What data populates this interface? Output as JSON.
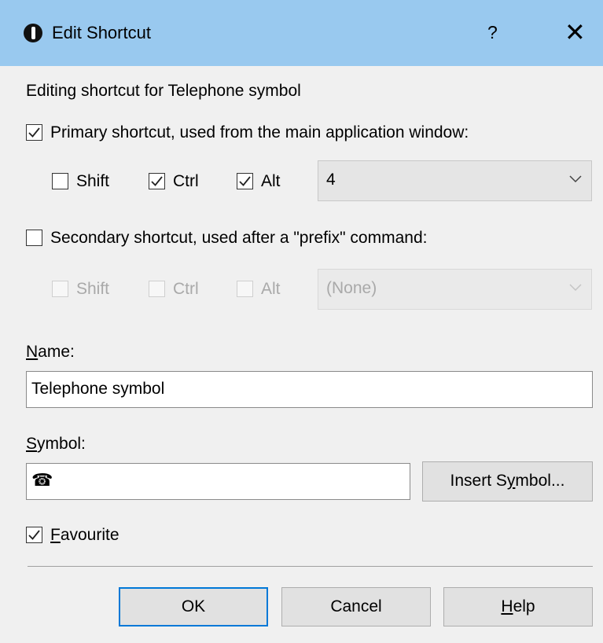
{
  "titlebar": {
    "title": "Edit Shortcut",
    "help": "?",
    "close": "✕"
  },
  "description": "Editing shortcut for Telephone symbol",
  "primary": {
    "checked": true,
    "label": "Primary shortcut, used from the main application window:",
    "shift": {
      "label": "Shift",
      "checked": false
    },
    "ctrl": {
      "label": "Ctrl",
      "checked": true
    },
    "alt": {
      "label": "Alt",
      "checked": true
    },
    "key": "4"
  },
  "secondary": {
    "checked": false,
    "label": "Secondary shortcut, used after a \"prefix\" command:",
    "shift": {
      "label": "Shift",
      "checked": false
    },
    "ctrl": {
      "label": "Ctrl",
      "checked": false
    },
    "alt": {
      "label": "Alt",
      "checked": false
    },
    "key": "(None)"
  },
  "name": {
    "label_first": "N",
    "label_rest": "ame:",
    "value": "Telephone symbol"
  },
  "symbol": {
    "label_first": "S",
    "label_rest": "ymbol:",
    "value": "☎",
    "insert_pre": "Insert S",
    "insert_u": "y",
    "insert_post": "mbol..."
  },
  "favourite": {
    "checked": true,
    "label_first": "F",
    "label_rest": "avourite"
  },
  "buttons": {
    "ok": "OK",
    "cancel": "Cancel",
    "help_first": "H",
    "help_rest": "elp"
  },
  "colors": {
    "titlebar": "#99c9ef",
    "default_button_border": "#0078d7"
  }
}
